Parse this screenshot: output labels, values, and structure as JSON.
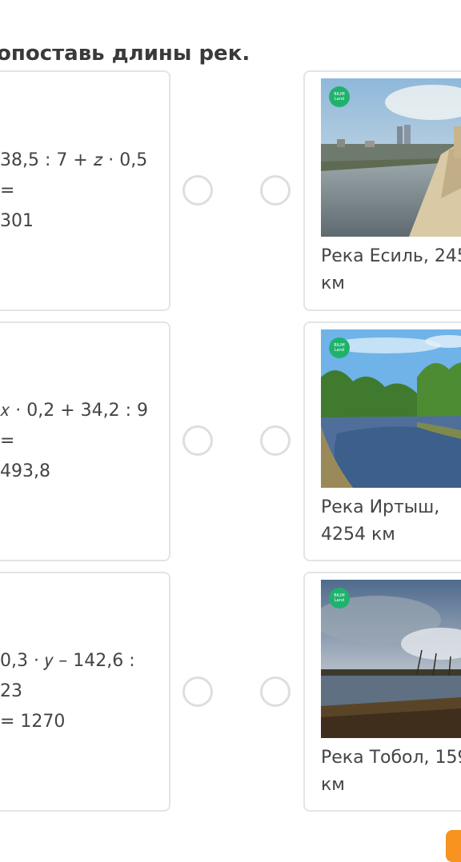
{
  "task": {
    "title": "опоставь длины рек."
  },
  "equations": [
    {
      "text": "38,5 : 7 + 𝑧 · 0,5 =\n301"
    },
    {
      "text": "𝑥 · 0,2 + 34,2 : 9 =\n493,8"
    },
    {
      "text": "0,3 · 𝑦 – 142,6 : 23\n= 1270"
    }
  ],
  "rivers": [
    {
      "caption": "Река Есиль, 245 км",
      "badge": "BILIM Land"
    },
    {
      "caption": "Река Иртыш, 4254 км",
      "badge": "BILIM Land"
    },
    {
      "caption": "Река Тобол, 159 км",
      "badge": "BILIM Land"
    }
  ]
}
